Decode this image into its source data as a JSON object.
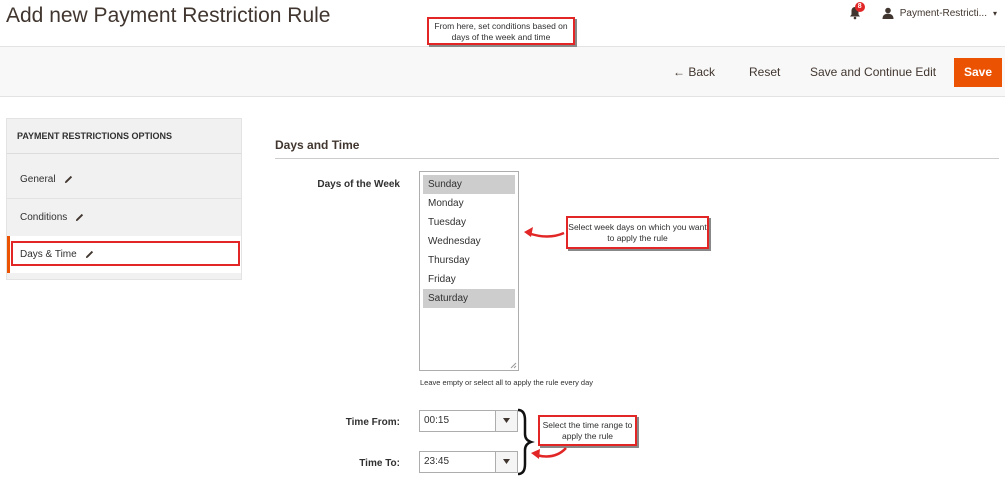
{
  "header": {
    "title": "Add new Payment Restriction Rule",
    "notification_count": "8",
    "user_name": "Payment-Restricti...",
    "user_caret": "▾"
  },
  "toolbar": {
    "back_label": "← Back",
    "reset_label": "Reset",
    "save_continue_label": "Save and Continue Edit",
    "save_label": "Save"
  },
  "sidebar": {
    "title": "PAYMENT RESTRICTIONS OPTIONS",
    "items": [
      {
        "label": "General"
      },
      {
        "label": "Conditions"
      },
      {
        "label": "Days & Time"
      }
    ]
  },
  "main": {
    "section_title": "Days and Time",
    "days_label": "Days of the Week",
    "days": [
      {
        "label": "Sunday",
        "selected": true
      },
      {
        "label": "Monday",
        "selected": false
      },
      {
        "label": "Tuesday",
        "selected": false
      },
      {
        "label": "Wednesday",
        "selected": false
      },
      {
        "label": "Thursday",
        "selected": false
      },
      {
        "label": "Friday",
        "selected": false
      },
      {
        "label": "Saturday",
        "selected": true
      }
    ],
    "days_hint": "Leave empty or select all to apply the rule every day",
    "time_from_label": "Time From:",
    "time_from_value": "00:15",
    "time_to_label": "Time To:",
    "time_to_value": "23:45"
  },
  "callouts": {
    "top": "From here, set conditions based on days of the week and time",
    "week": "Select week days on which you want to apply the rule",
    "time": "Select the time range to apply the rule"
  },
  "colors": {
    "accent": "#eb5202",
    "annotation": "#e22626"
  }
}
